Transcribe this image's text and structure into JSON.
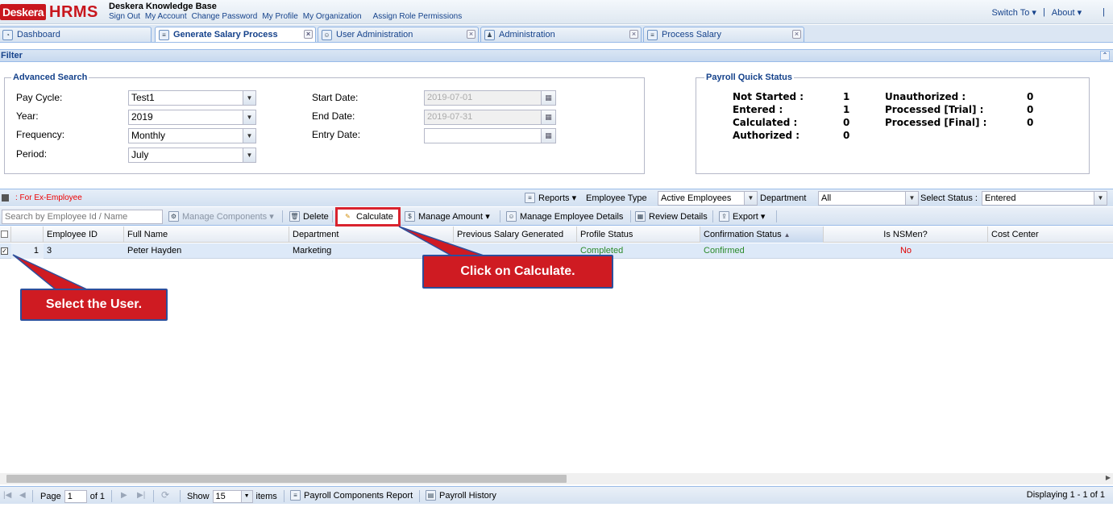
{
  "header": {
    "logo_part1": "Desk",
    "logo_part1b": "era",
    "logo_part2": "HRMS",
    "app_title": "Deskera Knowledge Base",
    "nav": [
      "Sign Out",
      "My Account",
      "Change Password",
      "My Profile",
      "My Organization",
      "Assign Role Permissions"
    ],
    "switch_to": "Switch To",
    "about": "About",
    "divider": "|"
  },
  "tabs": [
    {
      "label": "Dashboard",
      "active": false
    },
    {
      "label": "Generate Salary Process",
      "active": true
    },
    {
      "label": "User Administration",
      "active": false
    },
    {
      "label": "Administration",
      "active": false
    },
    {
      "label": "Process Salary",
      "active": false
    }
  ],
  "filter": {
    "title": "Filter",
    "advanced_search": {
      "legend": "Advanced Search",
      "pay_cycle_label": "Pay Cycle:",
      "pay_cycle_value": "Test1",
      "year_label": "Year:",
      "year_value": "2019",
      "frequency_label": "Frequency:",
      "frequency_value": "Monthly",
      "period_label": "Period:",
      "period_value": "July",
      "start_date_label": "Start Date:",
      "start_date_value": "2019-07-01",
      "end_date_label": "End Date:",
      "end_date_value": "2019-07-31",
      "entry_date_label": "Entry Date:",
      "entry_date_value": ""
    },
    "payroll_quick_status": {
      "legend": "Payroll Quick Status",
      "not_started_label": "Not Started :",
      "not_started_value": "1",
      "entered_label": "Entered :",
      "entered_value": "1",
      "calculated_label": "Calculated :",
      "calculated_value": "0",
      "authorized_label": "Authorized :",
      "authorized_value": "0",
      "unauthorized_label": "Unauthorized :",
      "unauthorized_value": "0",
      "processed_trial_label": "Processed [Trial] :",
      "processed_trial_value": "0",
      "processed_final_label": "Processed [Final] :",
      "processed_final_value": "0"
    }
  },
  "grid_bar": {
    "ex_employee": ": For Ex-Employee",
    "reports": "Reports",
    "employee_type_label": "Employee Type",
    "employee_type_value": "Active Employees",
    "department_label": "Department",
    "department_value": "All",
    "select_status_label": "Select Status :",
    "select_status_value": "Entered"
  },
  "toolbar": {
    "search_placeholder": "Search by Employee Id / Name",
    "manage_components": "Manage Components",
    "delete": "Delete",
    "calculate": "Calculate",
    "manage_amount": "Manage Amount",
    "manage_employee_details": "Manage Employee Details",
    "review_details": "Review Details",
    "export": "Export"
  },
  "grid": {
    "columns": [
      "Employee ID",
      "Full Name",
      "Department",
      "Previous Salary Generated",
      "Profile Status",
      "Confirmation Status",
      "Is NSMen?",
      "Cost Center"
    ],
    "rows": [
      {
        "num": "1",
        "employee_id": "3",
        "full_name": "Peter Hayden",
        "department": "Marketing",
        "previous_salary": "",
        "profile_status": "Completed",
        "confirmation_status": "Confirmed",
        "is_nsmen": "No",
        "cost_center": ""
      }
    ]
  },
  "pager": {
    "page_label": "Page",
    "page_value": "1",
    "of_label": "of 1",
    "show_label": "Show",
    "show_value": "15",
    "items_label": "items",
    "payroll_components_report": "Payroll Components Report",
    "payroll_history": "Payroll History",
    "displaying": "Displaying 1 - 1 of 1"
  },
  "callouts": {
    "calculate": "Click on Calculate.",
    "select_user": "Select the User."
  },
  "colors": {
    "accent_red": "#cf1b22",
    "link_blue": "#15428b",
    "status_green": "#2a8a2a",
    "status_red": "#e00000"
  }
}
